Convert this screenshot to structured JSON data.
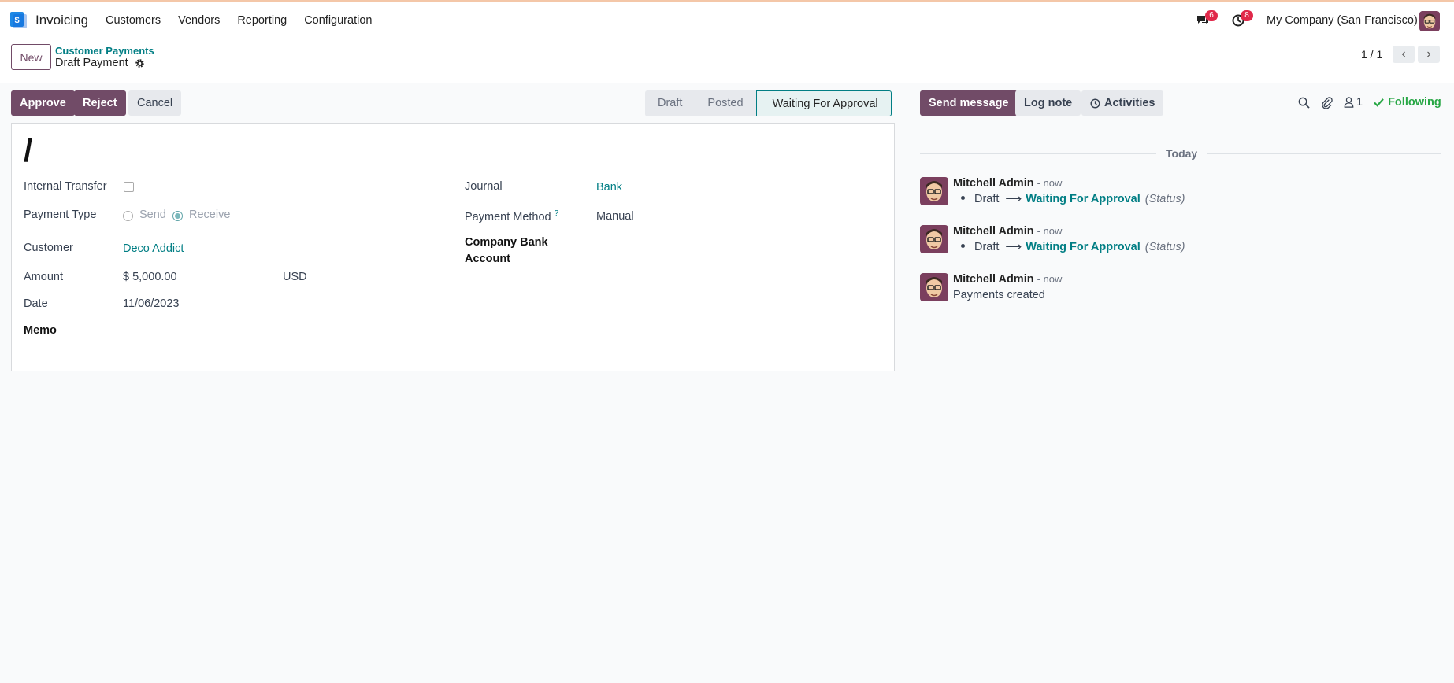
{
  "topbar": {
    "app_name": "Invoicing",
    "menu": [
      "Customers",
      "Vendors",
      "Reporting",
      "Configuration"
    ],
    "messages_count": "6",
    "activities_count": "8",
    "company": "My Company (San Francisco)"
  },
  "control": {
    "new_label": "New",
    "breadcrumb_parent": "Customer Payments",
    "breadcrumb_current": "Draft Payment",
    "pager_value": "1 / 1"
  },
  "actions": {
    "approve": "Approve",
    "reject": "Reject",
    "cancel": "Cancel"
  },
  "statusbar": {
    "steps": [
      "Draft",
      "Posted",
      "Waiting For Approval"
    ],
    "active": "Waiting For Approval"
  },
  "form": {
    "record_name": "/",
    "internal_transfer_label": "Internal Transfer",
    "payment_type_label": "Payment Type",
    "payment_type_options": [
      "Send",
      "Receive"
    ],
    "payment_type_selected": "Receive",
    "customer_label": "Customer",
    "customer_value": "Deco Addict",
    "amount_label": "Amount",
    "amount_value": "$ 5,000.00",
    "currency_value": "USD",
    "date_label": "Date",
    "date_value": "11/06/2023",
    "memo_label": "Memo",
    "journal_label": "Journal",
    "journal_value": "Bank",
    "payment_method_label": "Payment Method",
    "payment_method_help": "?",
    "payment_method_value": "Manual",
    "company_bank_label_line1": "Company Bank",
    "company_bank_label_line2": "Account"
  },
  "chatter": {
    "send_message": "Send message",
    "log_note": "Log note",
    "activities": "Activities",
    "followers_count": "1",
    "following": "Following",
    "date_separator": "Today",
    "messages": [
      {
        "author": "Mitchell Admin",
        "time": "- now",
        "old": "Draft",
        "new": "Waiting For Approval",
        "field": "(Status)"
      },
      {
        "author": "Mitchell Admin",
        "time": "- now",
        "old": "Draft",
        "new": "Waiting For Approval",
        "field": "(Status)"
      },
      {
        "author": "Mitchell Admin",
        "time": "- now",
        "text": "Payments created"
      }
    ]
  },
  "colors": {
    "primary": "#714b67",
    "link": "#017e84",
    "following": "#28a745",
    "badge": "#e0294a"
  }
}
